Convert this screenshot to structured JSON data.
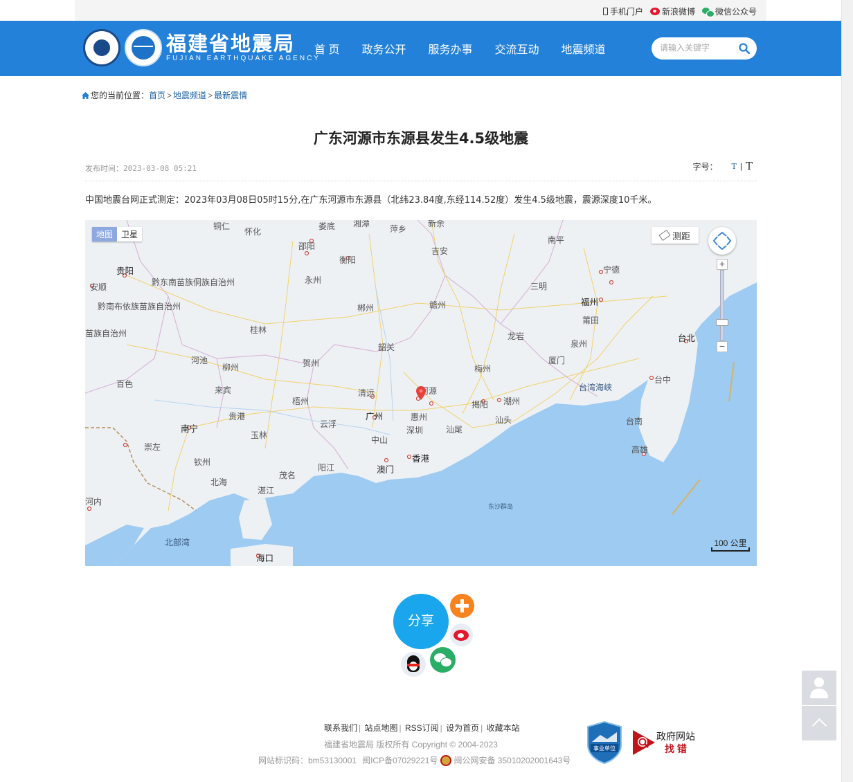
{
  "topbar": {
    "mobile_label": "手机门户",
    "weibo_label": "新浪微博",
    "wechat_label": "微信公众号"
  },
  "header": {
    "logo_cn": "福建省地震局",
    "logo_en": "FUJIAN EARTHQUAKE AGENCY",
    "logo_badge": "FJEA",
    "nav": [
      "首 页",
      "政务公开",
      "服务办事",
      "交流互动",
      "地震频道"
    ],
    "search_placeholder": "请输入关键字"
  },
  "breadcrumb": {
    "prefix": "您的当前位置：",
    "items": [
      "首页",
      "地震频道",
      "最新震情"
    ],
    "separator": ">"
  },
  "article": {
    "title": "广东河源市东源县发生4.5级地震",
    "pubtime": "发布时间：2023-03-08 05:21",
    "fontsize_label": "字号：",
    "fontsize_small": "T",
    "fontsize_divider": "|",
    "fontsize_large": "T",
    "body": "中国地震台网正式测定：2023年03月08日05时15分,在广东河源市东源县（北纬23.84度,东经114.52度）发生4.5级地震，震源深度10千米。"
  },
  "map": {
    "type_map": "地图",
    "type_satellite": "卫星",
    "measure_label": "测距",
    "zoom_in": "+",
    "zoom_out": "−",
    "scale_label": "100 公里",
    "labels": {
      "tongren": "铜仁",
      "huaihua": "怀化",
      "loudi": "娄底",
      "xiangtan": "湘潭",
      "pingxiang": "萍乡",
      "xinyu": "新余",
      "nanping": "南平",
      "guiyang": "贵阳",
      "shaoyang": "邵阳",
      "hengyang": "衡阳",
      "jian": "吉安",
      "ningde": "宁德",
      "anshun": "安顺",
      "qiandongnan": "黔东南苗族侗族自治州",
      "yongzhou": "永州",
      "sanming": "三明",
      "qiannan": "黔南布依族苗族自治州",
      "chenzhou": "郴州",
      "ganzhou": "赣州",
      "fuzhou": "福州",
      "putian": "莆田",
      "zizhizhou": "苗族自治州",
      "guilin": "桂林",
      "shaoguan": "韶关",
      "longyan": "龙岩",
      "quanzhou": "泉州",
      "taibei": "台北",
      "hechi": "河池",
      "liuzhou": "柳州",
      "hezhou": "贺州",
      "meizhou": "梅州",
      "xiamen": "厦门",
      "baise": "百色",
      "laibin": "来宾",
      "qingyuan": "清远",
      "heyuan": "河源",
      "jieyang": "揭阳",
      "chaozhou": "潮州",
      "taiwan_strait": "台湾海峡",
      "taizhong": "台中",
      "wuzhou": "梧州",
      "guangzhou": "广州",
      "huizhou": "惠州",
      "shantou": "汕头",
      "nanning": "南宁",
      "guigang": "贵港",
      "yunfu": "云浮",
      "shenzhen": "深圳",
      "shanwei": "汕尾",
      "tainan": "台南",
      "yulin": "玉林",
      "zhongshan": "中山",
      "chongzuo": "崇左",
      "qinzhou": "钦州",
      "yangjiang": "阳江",
      "xianggang": "香港",
      "gaoxiong": "高雄",
      "aomen": "澳门",
      "beihai": "北海",
      "maoming": "茂名",
      "zhanjiang": "湛江",
      "henei": "河内",
      "dongsha": "东沙群岛",
      "beibuwan": "北部湾",
      "haikou": "海口"
    }
  },
  "share": {
    "label": "分享"
  },
  "footer": {
    "links": [
      "联系我们",
      "站点地图",
      "RSS订阅",
      "设为首页",
      "收藏本站"
    ],
    "copyright": "福建省地震局  版权所有   Copyright © 2004-2023",
    "site_id": "网站标识码：bm53130001",
    "icp": "闽ICP备07029221号",
    "police": "闽公网安备 35010202001643号",
    "badge_unit": "事业单位",
    "gov_find_1": "政府网站",
    "gov_find_2": "找 错"
  },
  "colors": {
    "header_blue": "#2381d9",
    "share_blue": "#19a6ec",
    "link_blue": "#1a5fa0",
    "sea": "#9ecbf1",
    "land": "#eef1f4",
    "marker_red": "#e8413a"
  }
}
